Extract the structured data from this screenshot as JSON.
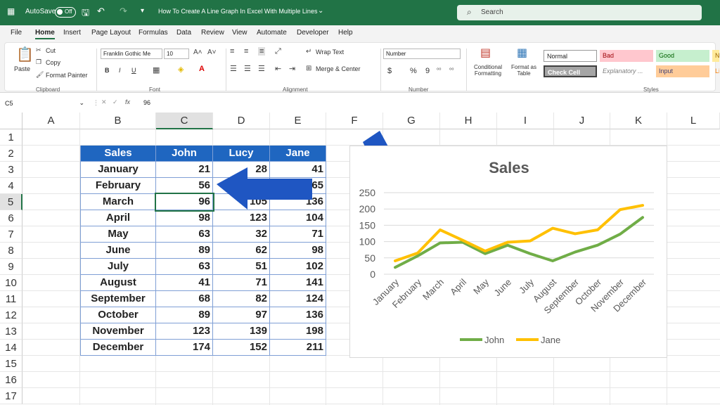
{
  "titlebar": {
    "autosave_label": "AutoSave",
    "autosave_state": "Off",
    "document_title": "How To Create A Line Graph In Excel With Multiple Lines",
    "search_placeholder": "Search"
  },
  "ribbon_tabs": [
    "File",
    "Home",
    "Insert",
    "Page Layout",
    "Formulas",
    "Data",
    "Review",
    "View",
    "Automate",
    "Developer",
    "Help"
  ],
  "active_tab": "Home",
  "ribbon": {
    "clipboard": {
      "paste": "Paste",
      "cut": "Cut",
      "copy": "Copy",
      "format_painter": "Format Painter",
      "group": "Clipboard"
    },
    "font": {
      "name": "Franklin Gothic Me",
      "size": "10",
      "group": "Font",
      "bold": "B",
      "italic": "I",
      "underline": "U"
    },
    "alignment": {
      "wrap_text": "Wrap Text",
      "merge_center": "Merge & Center",
      "group": "Alignment"
    },
    "number": {
      "format": "Number",
      "group": "Number",
      "currency": "$",
      "percent": "%",
      "comma": "9"
    },
    "styles": {
      "conditional_formatting": "Conditional Formatting",
      "format_as_table": "Format as Table",
      "normal": "Normal",
      "bad": "Bad",
      "good": "Good",
      "neutral": "Ne",
      "check_cell": "Check Cell",
      "explanatory": "Explanatory ...",
      "input": "Input",
      "linked": "Lin",
      "group": "Styles"
    }
  },
  "formula_bar": {
    "cell_ref": "C5",
    "fx": "fx",
    "value": "96"
  },
  "columns": [
    "A",
    "B",
    "C",
    "D",
    "E",
    "F",
    "G",
    "H",
    "I",
    "J",
    "K",
    "L"
  ],
  "selected_column": "C",
  "rows": [
    "1",
    "2",
    "3",
    "4",
    "5",
    "6",
    "7",
    "8",
    "9",
    "10",
    "11",
    "12",
    "13",
    "14",
    "15",
    "16",
    "17"
  ],
  "selected_row": "5",
  "table": {
    "headers": [
      "Sales",
      "John",
      "Lucy",
      "Jane"
    ],
    "rows": [
      [
        "January",
        "21",
        "28",
        "41"
      ],
      [
        "February",
        "56",
        "",
        "65"
      ],
      [
        "March",
        "96",
        "105",
        "136"
      ],
      [
        "April",
        "98",
        "123",
        "104"
      ],
      [
        "May",
        "63",
        "32",
        "71"
      ],
      [
        "June",
        "89",
        "62",
        "98"
      ],
      [
        "July",
        "63",
        "51",
        "102"
      ],
      [
        "August",
        "41",
        "71",
        "141"
      ],
      [
        "September",
        "68",
        "82",
        "124"
      ],
      [
        "October",
        "89",
        "97",
        "136"
      ],
      [
        "November",
        "123",
        "139",
        "198"
      ],
      [
        "December",
        "174",
        "152",
        "211"
      ]
    ]
  },
  "chart_data": {
    "type": "line",
    "title": "Sales",
    "categories": [
      "January",
      "February",
      "March",
      "April",
      "May",
      "June",
      "July",
      "August",
      "September",
      "October",
      "November",
      "December"
    ],
    "series": [
      {
        "name": "John",
        "color": "#70ad47",
        "values": [
          21,
          56,
          96,
          98,
          63,
          89,
          63,
          41,
          68,
          89,
          123,
          174
        ]
      },
      {
        "name": "Jane",
        "color": "#ffc000",
        "values": [
          41,
          65,
          136,
          104,
          71,
          98,
          102,
          141,
          124,
          136,
          198,
          211
        ]
      }
    ],
    "yticks": [
      "0",
      "50",
      "100",
      "150",
      "200",
      "250"
    ],
    "ylim": [
      0,
      250
    ],
    "grid": true,
    "legend": "bottom"
  },
  "colors": {
    "excel_green": "#217346",
    "table_header": "#1f66c0",
    "arrow_blue": "#1f56c2"
  }
}
